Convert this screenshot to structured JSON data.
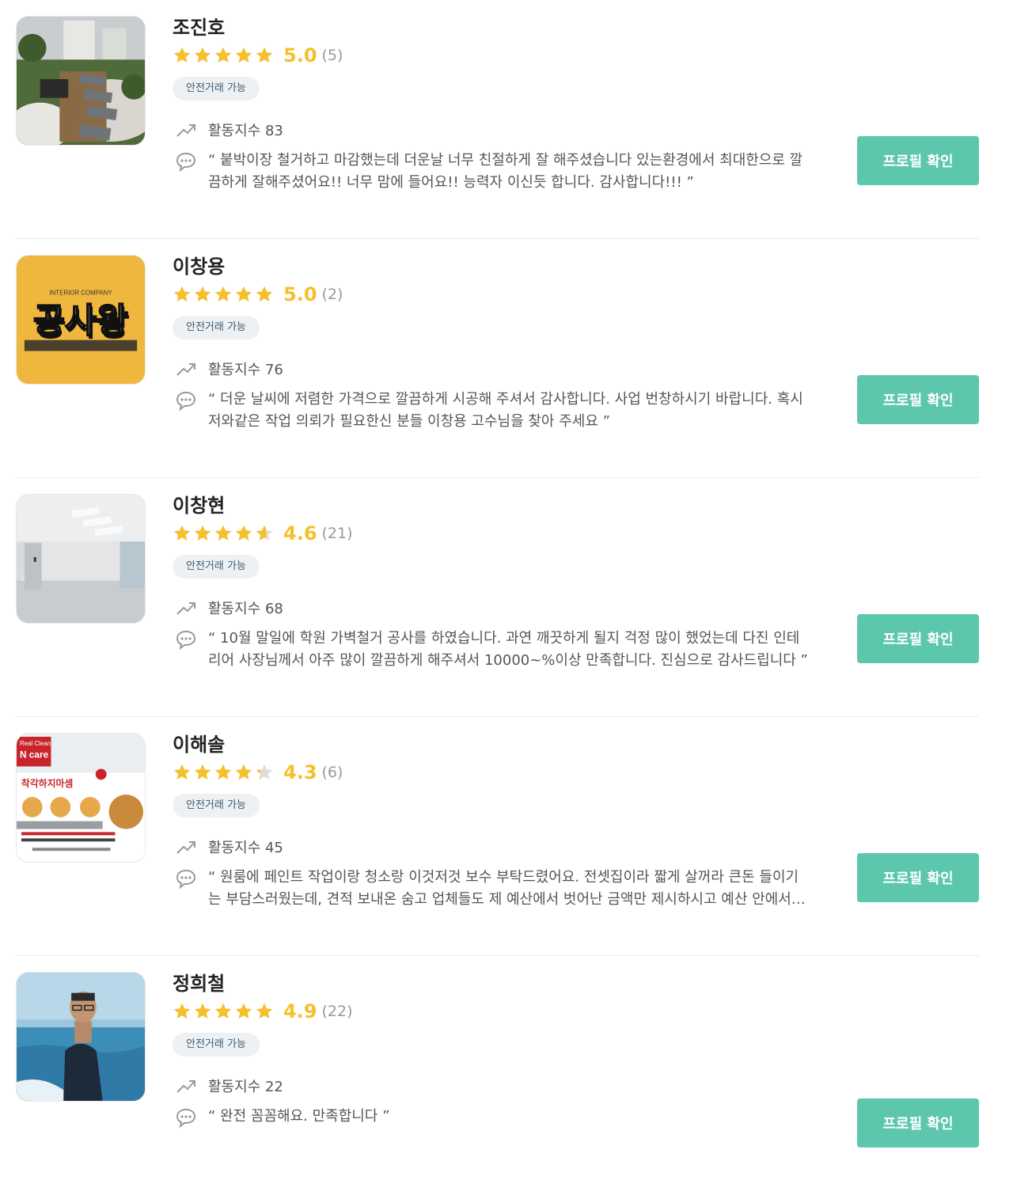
{
  "pros": [
    {
      "name": "조진호",
      "rating": 5.0,
      "score_text": "5.0",
      "review_count_text": "(5)",
      "badge": "안전거래 가능",
      "activity_text": "활동지수 83",
      "review": "“ 붙박이장 철거하고 마감했는데 더운날 너무 친절하게 잘 해주셨습니다 있는환경에서 최대한으로 깔끔하게 잘해주셨어요!! 너무 맘에 들어요!! 능력자 이신듯 합니다. 감사합니다!!! ”",
      "button": "프로필 확인",
      "avatar_icon": "garden-photo"
    },
    {
      "name": "이창용",
      "rating": 5.0,
      "score_text": "5.0",
      "review_count_text": "(2)",
      "badge": "안전거래 가능",
      "activity_text": "활동지수 76",
      "review": "“ 더운 날씨에 저렴한 가격으로 깔끔하게 시공해 주셔서 감사합니다. 사업 번창하시기 바랍니다. 혹시 저와같은 작업 의뢰가 필요한신 분들 이창용 고수님을 찾아 주세요 ”",
      "button": "프로필 확인",
      "avatar_icon": "logo-image",
      "logo_small": "INTERIOR COMPANY",
      "logo_main": "공사왕"
    },
    {
      "name": "이창현",
      "rating": 4.6,
      "score_text": "4.6",
      "review_count_text": "(21)",
      "badge": "안전거래 가능",
      "activity_text": "활동지수 68",
      "review": "“ 10월 말일에 학원 가벽철거 공사를 하였습니다. 과연 깨끗하게 될지 걱정 많이 했었는데 다진 인테리어 사장님께서 아주 많이 깔끔하게 해주셔서 10000~%이상 만족합니다. 진심으로 감사드립니다 ”",
      "button": "프로필 확인",
      "avatar_icon": "interior-room-photo"
    },
    {
      "name": "이해솔",
      "rating": 4.3,
      "score_text": "4.3",
      "review_count_text": "(6)",
      "badge": "안전거래 가능",
      "activity_text": "활동지수 45",
      "review": "“ 원룸에 페인트 작업이랑 청소랑 이것저것 보수 부탁드렸어요. 전셋집이라 짧게 살꺼라 큰돈 들이기는 부담스러웠는데, 견적 보내온 숨고 업체들도 제 예산에서 벗어난 금액만 제시하시고 예산 안에서 해주셨어요 ”",
      "button": "프로필 확인",
      "avatar_icon": "cleaning-flyer-image",
      "flyer_tag_1": "Real Clean",
      "flyer_tag_2": "N care",
      "flyer_headline": "착각하지마셈"
    },
    {
      "name": "정희철",
      "rating": 4.9,
      "score_text": "4.9",
      "review_count_text": "(22)",
      "badge": "안전거래 가능",
      "activity_text": "활동지수 22",
      "review": "“ 완전 꼼꼼해요. 만족합니다 ”",
      "button": "프로필 확인",
      "avatar_icon": "person-photo"
    }
  ],
  "colors": {
    "star": "#f6c02c",
    "star_empty": "#dddddd",
    "button": "#5cc7ad",
    "badge_bg": "#edf1f4"
  }
}
